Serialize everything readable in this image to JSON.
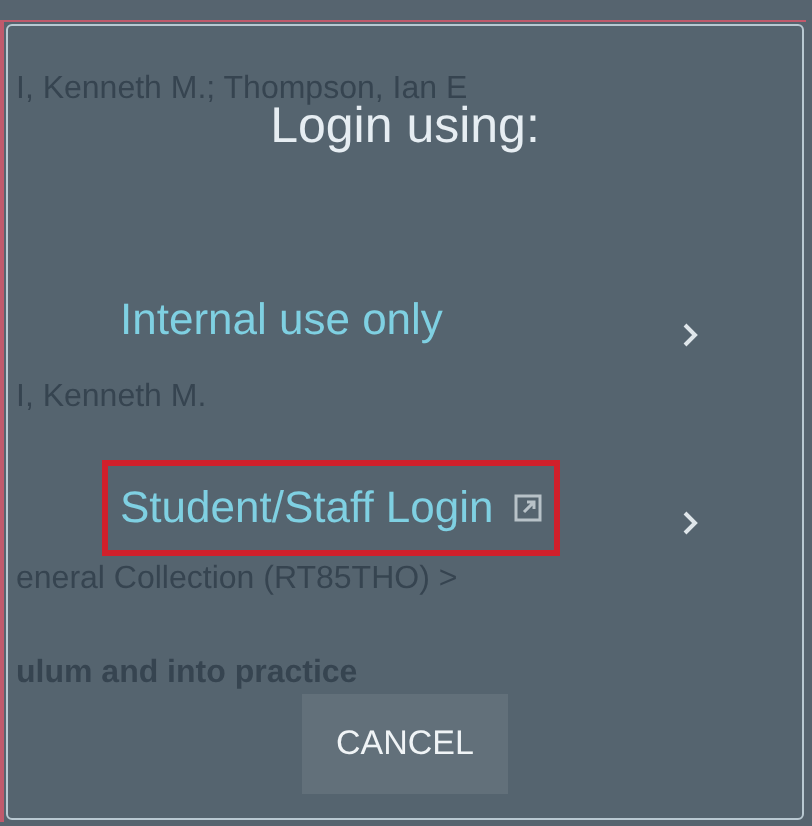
{
  "background_texts": [
    {
      "text": "I, Kenneth M.; Thompson, Ian E",
      "kind": "plain"
    },
    {
      "text": "I, Kenneth M.",
      "kind": "plain"
    },
    {
      "text": "eneral Collection (RT85THO) >",
      "kind": "plain"
    },
    {
      "text": "ulum and into practice",
      "kind": "bold"
    }
  ],
  "dialog": {
    "title": "Login using:",
    "options": [
      {
        "label": "Internal use only",
        "external": false,
        "focused": false
      },
      {
        "label": "Student/Staff Login",
        "external": true,
        "focused": true
      }
    ],
    "cancel": "CANCEL"
  }
}
